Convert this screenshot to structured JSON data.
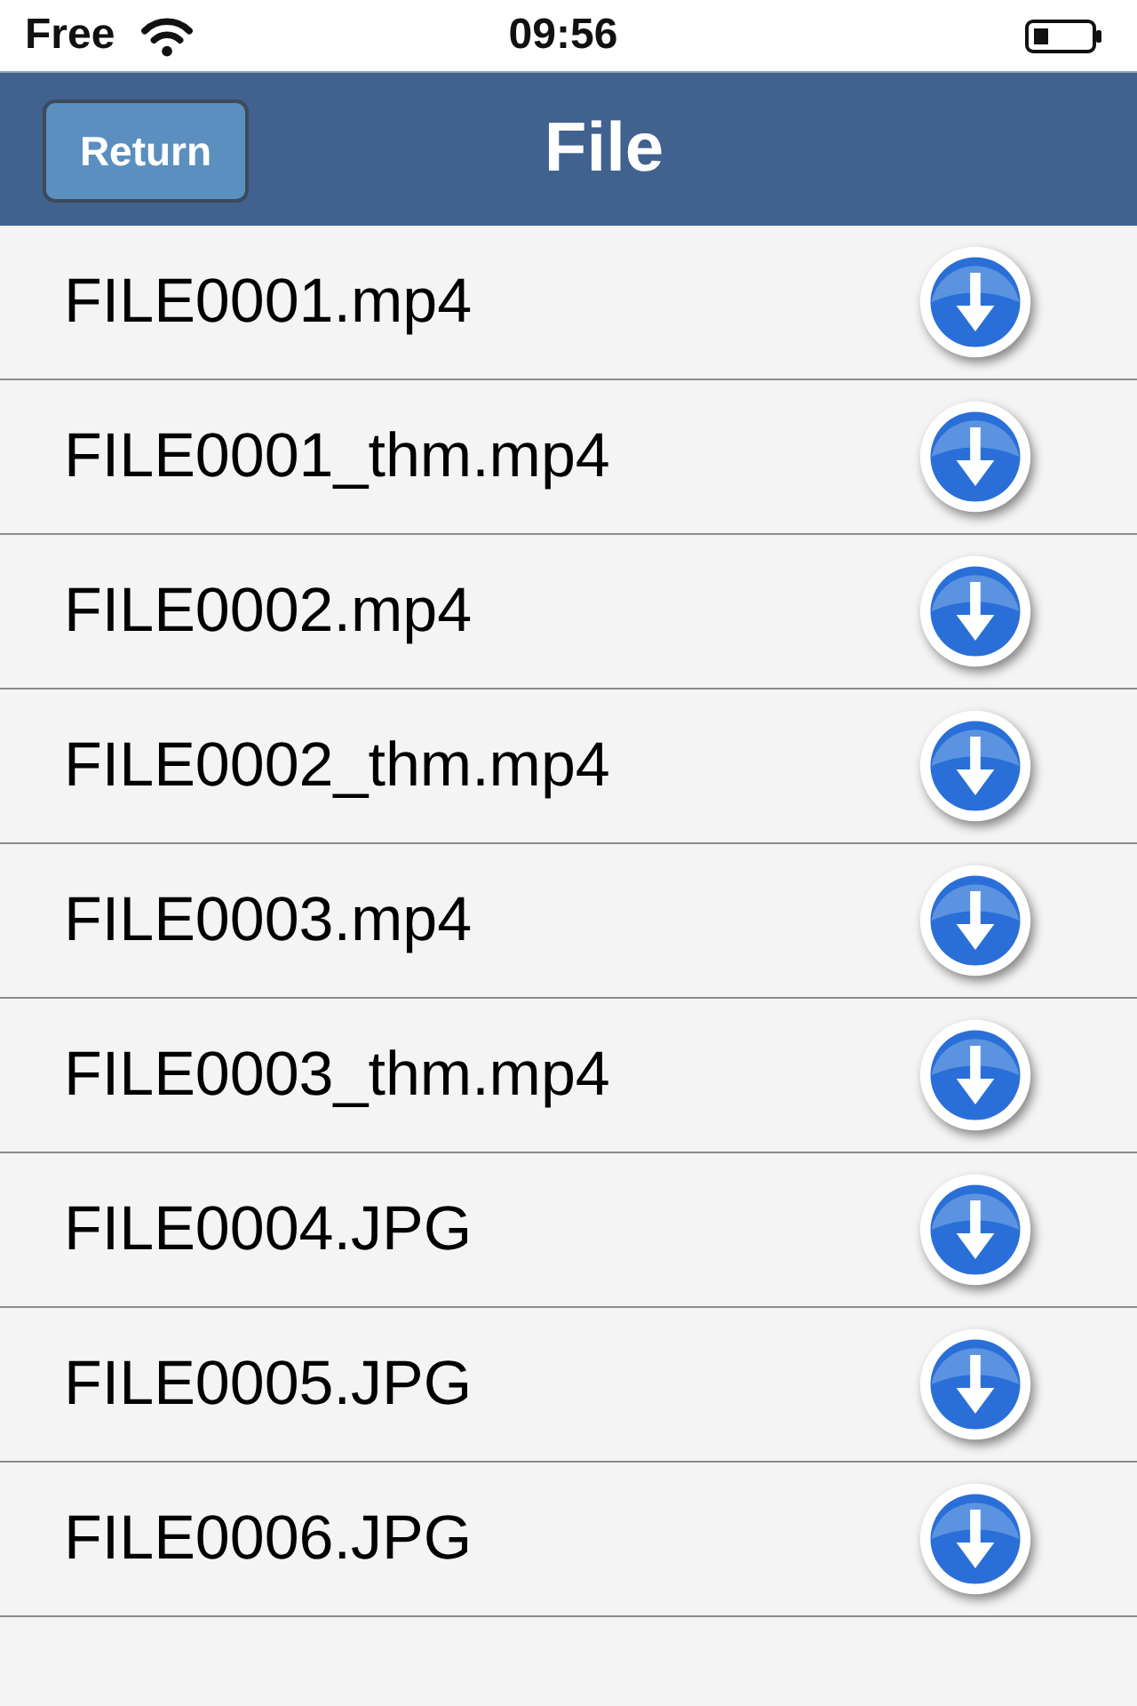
{
  "status_bar": {
    "carrier": "Free",
    "time": "09:56"
  },
  "nav_bar": {
    "back_button": "Return",
    "title": "File"
  },
  "files": [
    {
      "name": "FILE0001.mp4"
    },
    {
      "name": "FILE0001_thm.mp4"
    },
    {
      "name": "FILE0002.mp4"
    },
    {
      "name": "FILE0002_thm.mp4"
    },
    {
      "name": "FILE0003.mp4"
    },
    {
      "name": "FILE0003_thm.mp4"
    },
    {
      "name": "FILE0004.JPG"
    },
    {
      "name": "FILE0005.JPG"
    },
    {
      "name": "FILE0006.JPG"
    }
  ]
}
